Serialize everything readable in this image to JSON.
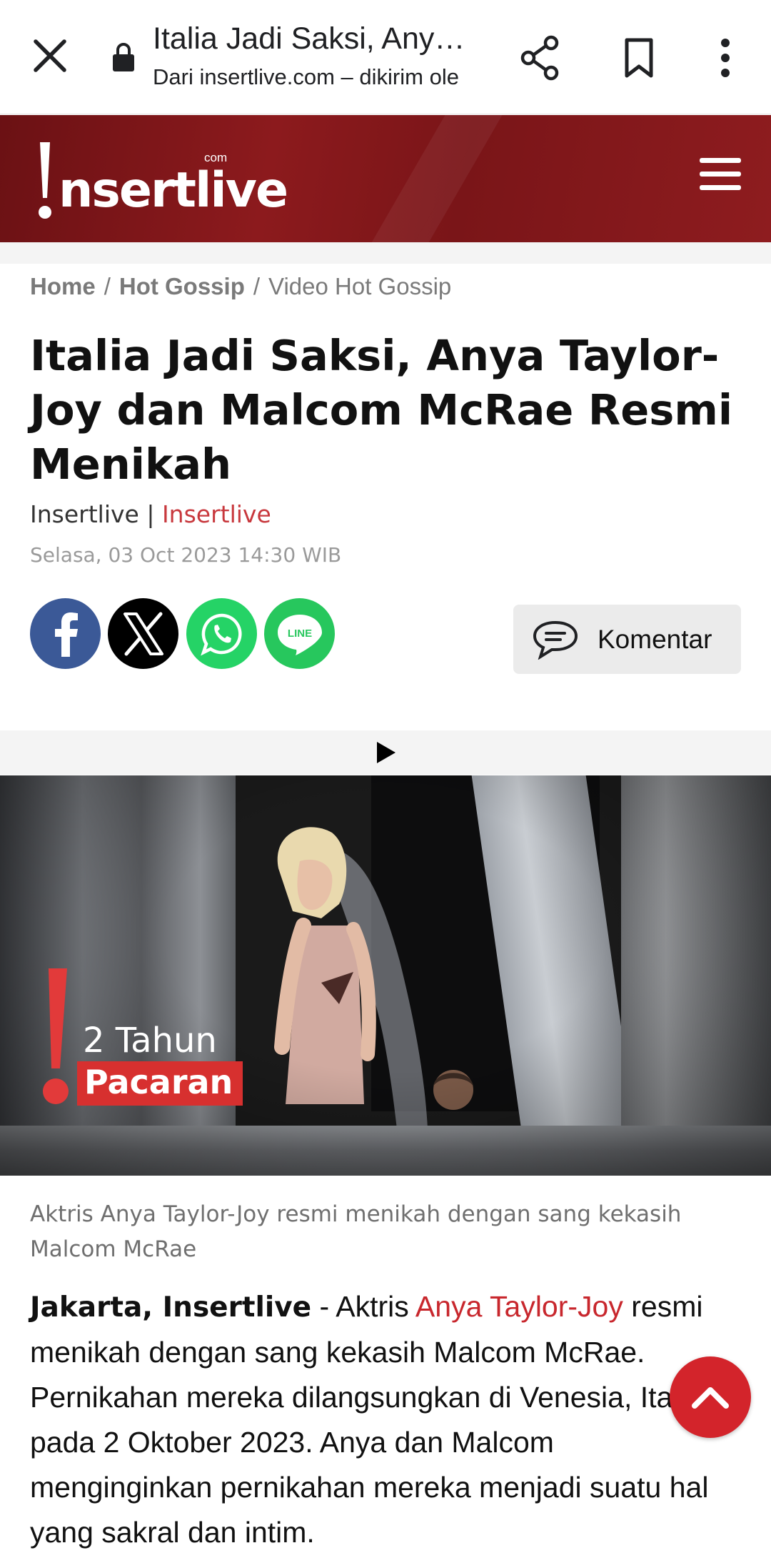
{
  "browser": {
    "title": "Italia Jadi Saksi, Any…",
    "subtitle": "Dari insertlive.com – dikirim ole",
    "icons": [
      "close-icon",
      "lock-icon",
      "share-icon",
      "bookmark-icon",
      "more-vert-icon"
    ]
  },
  "site": {
    "logo_text": "nsertlive",
    "logo_com": "com",
    "brand_color": "#8c1a1d",
    "menu_icon": "hamburger-menu-icon"
  },
  "breadcrumb": {
    "items": [
      "Home",
      "Hot Gossip",
      "Video Hot Gossip"
    ],
    "separator": "/"
  },
  "article": {
    "title": "Italia Jadi Saksi, Anya Taylor-Joy dan Malcom McRae Resmi Menikah",
    "byline_source": "Insertlive",
    "byline_divider": " | ",
    "byline_author": "Insertlive",
    "date": "Selasa, 03 Oct 2023 14:30 WIB",
    "comment_label": "Komentar",
    "share_icons": [
      "facebook-icon",
      "x-twitter-icon",
      "whatsapp-icon",
      "line-icon"
    ]
  },
  "video": {
    "overlay_line1": "2 Tahun",
    "overlay_line2": "Pacaran",
    "caption": "Aktris Anya Taylor-Joy resmi menikah dengan sang kekasih Malcom McRae"
  },
  "body": {
    "lead": "Jakarta, Insertlive",
    "dash": " - Aktris ",
    "link": "Anya Taylor-Joy",
    "text": " resmi menikah dengan sang kekasih Malcom McRae. Pernikahan mereka dilangsungkan di Venesia, Itali pada 2 Oktober 2023. Anya dan Malcom menginginkan pernikahan mereka menjadi suatu hal yang sakral dan intim."
  },
  "colors": {
    "accent_red": "#d3242b",
    "link_red": "#c8272d",
    "facebook": "#3b5997",
    "whatsapp": "#25d366",
    "line": "#27c75d"
  }
}
